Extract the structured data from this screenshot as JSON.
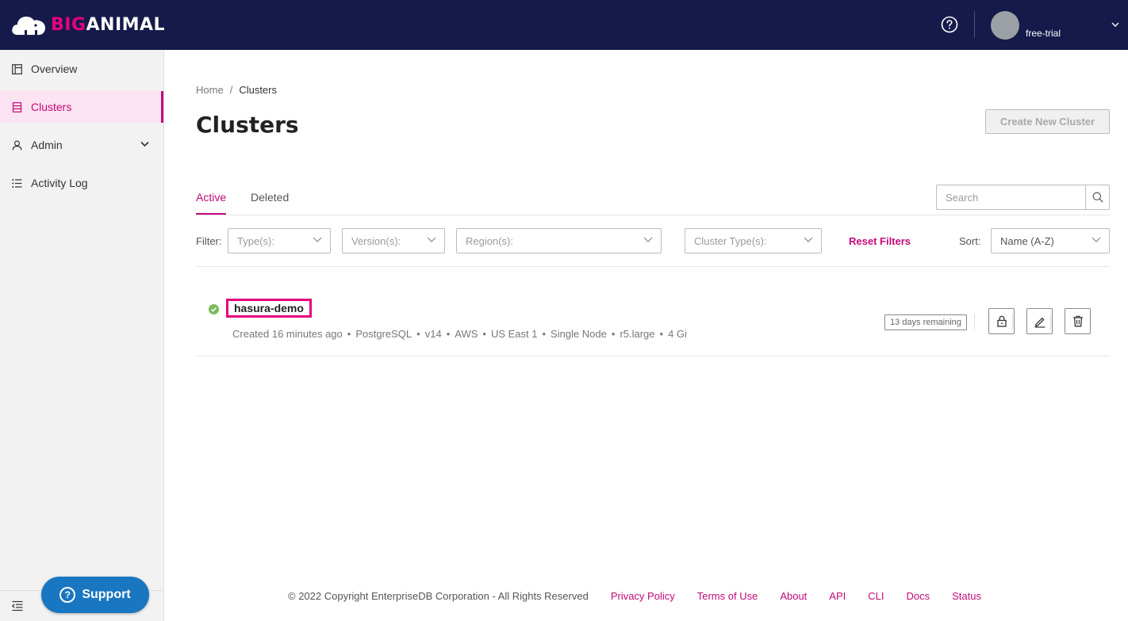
{
  "brand": {
    "logo_big": "BIG",
    "logo_animal": "ANIMAL",
    "accent": "#e6007e",
    "navbar_bg": "#161a4a"
  },
  "header": {
    "help_icon": "question-circle-icon",
    "user_name": "free-trial"
  },
  "sidebar": {
    "items": [
      {
        "label": "Overview",
        "icon": "layout-icon"
      },
      {
        "label": "Clusters",
        "icon": "database-icon",
        "active": true
      },
      {
        "label": "Admin",
        "icon": "user-icon",
        "expandable": true
      },
      {
        "label": "Activity Log",
        "icon": "list-icon"
      }
    ],
    "support_label": "Support"
  },
  "breadcrumb": {
    "home": "Home",
    "separator": "/",
    "current": "Clusters"
  },
  "page": {
    "title": "Clusters",
    "create_button": "Create New Cluster"
  },
  "tabs": {
    "active": "Active",
    "deleted": "Deleted"
  },
  "search": {
    "placeholder": "Search"
  },
  "filters": {
    "label": "Filter:",
    "types_placeholder": "Type(s):",
    "versions_placeholder": "Version(s):",
    "regions_placeholder": "Region(s):",
    "cluster_types_placeholder": "Cluster Type(s):",
    "reset_label": "Reset Filters",
    "sort_label": "Sort:",
    "sort_value": "Name (A-Z)"
  },
  "clusters": [
    {
      "name": "hasura-demo",
      "status_color": "#7cb95a",
      "created": "Created 16 minutes ago",
      "engine": "PostgreSQL",
      "version": "v14",
      "provider": "AWS",
      "region": "US East 1",
      "type": "Single Node",
      "instance": "r5.large",
      "storage": "4 Gi",
      "separator": "•",
      "badge": "13 days remaining"
    }
  ],
  "footer": {
    "copyright": "© 2022 Copyright EnterpriseDB Corporation - All Rights Reserved",
    "links": [
      "Privacy Policy",
      "Terms of Use",
      "About",
      "API",
      "CLI",
      "Docs",
      "Status"
    ]
  }
}
